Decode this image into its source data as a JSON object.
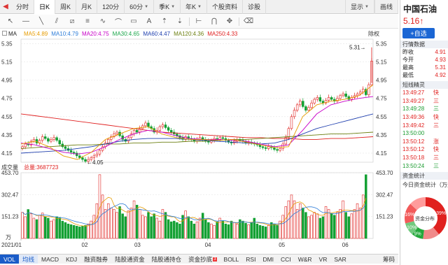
{
  "period_tabs": [
    "分时",
    "日K",
    "周K",
    "月K",
    "120分",
    "60分",
    "季K",
    "年K",
    "个股资料",
    "诊股"
  ],
  "period_active_index": 1,
  "period_right": [
    "显示",
    "画线"
  ],
  "ma_legend": {
    "label": "MA",
    "items": [
      {
        "label": "MA5:4.89",
        "color": "#e69b00"
      },
      {
        "label": "MA10:4.79",
        "color": "#2e7dd8"
      },
      {
        "label": "MA20:4.75",
        "color": "#c800c8"
      },
      {
        "label": "MA30:4.65",
        "color": "#1aa64a"
      },
      {
        "label": "MA60:4.47",
        "color": "#1f3fae"
      },
      {
        "label": "MA120:4.36",
        "color": "#6c7f10"
      },
      {
        "label": "MA250:4.33",
        "color": "#e02020"
      }
    ],
    "rq_label": "除权"
  },
  "chart_data": [
    {
      "type": "candlestick",
      "title": "",
      "y_axis_ticks": [
        "5.35",
        "5.15",
        "4.95",
        "4.75",
        "4.55",
        "4.35",
        "4.15"
      ],
      "ylim": [
        4.05,
        5.4
      ],
      "x_axis_ticks": [
        "2021/01",
        "02",
        "03",
        "04",
        "05",
        "06"
      ],
      "annotations": [
        {
          "text": "5.31",
          "value": 5.31
        },
        {
          "text": "4.05",
          "value": 4.05
        }
      ],
      "close_series": [
        4.22,
        4.25,
        4.24,
        4.28,
        4.3,
        4.26,
        4.29,
        4.33,
        4.31,
        4.28,
        4.3,
        4.32,
        4.29,
        4.25,
        4.22,
        4.2,
        4.18,
        4.16,
        4.15,
        4.12,
        4.1,
        4.08,
        4.06,
        4.08,
        4.1,
        4.12,
        4.14,
        4.18,
        4.22,
        4.26,
        4.3,
        4.33,
        4.36,
        4.38,
        4.34,
        4.3,
        4.28,
        4.32,
        4.36,
        4.4,
        4.38,
        4.42,
        4.45,
        4.48,
        4.44,
        4.42,
        4.38,
        4.4,
        4.44,
        4.46,
        4.43,
        4.4,
        4.38,
        4.36,
        4.34,
        4.32,
        4.3,
        4.33,
        4.31,
        4.3,
        4.28,
        4.3,
        4.32,
        4.3,
        4.28,
        4.27,
        4.29,
        4.31,
        4.3,
        4.32,
        4.31,
        4.29,
        4.27,
        4.26,
        4.28,
        4.3,
        4.29,
        4.28,
        4.26,
        4.27,
        4.26,
        4.25,
        4.24,
        4.22,
        4.21,
        4.2,
        4.22,
        4.21,
        4.19,
        4.18,
        4.2,
        4.25,
        4.32,
        4.42,
        4.55,
        4.62,
        4.68,
        4.72,
        4.66,
        4.62,
        4.65,
        4.7,
        4.74,
        4.76,
        4.72,
        4.7,
        4.73,
        4.76,
        4.74,
        4.72,
        4.75,
        4.78,
        4.8,
        4.77,
        4.74,
        4.76,
        4.78,
        4.8,
        4.82,
        4.85,
        4.79,
        4.9,
        5.16
      ],
      "ma_lines": [
        {
          "name": "MA250",
          "color": "#e02020",
          "values": [
            4.58,
            4.56,
            4.54,
            4.52,
            4.5,
            4.48,
            4.46,
            4.44,
            4.42,
            4.4,
            4.38,
            4.37,
            4.36,
            4.35,
            4.34,
            4.33,
            4.32,
            4.32,
            4.31,
            4.31,
            4.3,
            4.3,
            4.31,
            4.31,
            4.32,
            4.33
          ]
        },
        {
          "name": "MA120",
          "color": "#6c7f10",
          "values": [
            4.2,
            4.21,
            4.22,
            4.23,
            4.24,
            4.24,
            4.25,
            4.25,
            4.26,
            4.26,
            4.27,
            4.27,
            4.28,
            4.28,
            4.29,
            4.3,
            4.3,
            4.31,
            4.32,
            4.33,
            4.34,
            4.35,
            4.36,
            4.36,
            4.37,
            4.38
          ]
        },
        {
          "name": "MA60",
          "color": "#1f3fae",
          "values": [
            4.15,
            4.16,
            4.17,
            4.18,
            4.2,
            4.22,
            4.25,
            4.28,
            4.3,
            4.31,
            4.31,
            4.31,
            4.3,
            4.29,
            4.28,
            4.27,
            4.26,
            4.25,
            4.26,
            4.3,
            4.36,
            4.42,
            4.46,
            4.5,
            4.54,
            4.58
          ]
        },
        {
          "name": "MA20",
          "color": "#c800c8",
          "values": [
            4.26,
            4.24,
            4.2,
            4.16,
            4.14,
            4.16,
            4.22,
            4.3,
            4.36,
            4.4,
            4.38,
            4.34,
            4.31,
            4.3,
            4.3,
            4.29,
            4.28,
            4.25,
            4.22,
            4.24,
            4.4,
            4.58,
            4.68,
            4.72,
            4.75,
            4.77
          ]
        },
        {
          "name": "MA5",
          "color": "#e69b00",
          "values": [
            4.25,
            4.28,
            4.22,
            4.12,
            4.08,
            4.16,
            4.3,
            4.36,
            4.42,
            4.44,
            4.36,
            4.32,
            4.3,
            4.3,
            4.29,
            4.3,
            4.27,
            4.24,
            4.21,
            4.22,
            4.55,
            4.68,
            4.72,
            4.74,
            4.78,
            4.9
          ]
        }
      ]
    },
    {
      "type": "bar",
      "title": "成交量",
      "legend": "总量:3687723",
      "y_axis_ticks": [
        "453.70",
        "302.47",
        "151.23"
      ],
      "y_unit": "万",
      "ylim": [
        0,
        453.7
      ],
      "values": [
        180,
        150,
        200,
        170,
        140,
        130,
        160,
        175,
        150,
        140,
        120,
        130,
        150,
        145,
        120,
        110,
        100,
        95,
        90,
        85,
        80,
        85,
        90,
        100,
        120,
        160,
        240,
        440,
        300,
        200,
        240,
        210,
        200,
        180,
        220,
        170,
        150,
        190,
        210,
        260,
        230,
        200,
        160,
        150,
        180,
        150,
        170,
        140,
        120,
        200,
        180,
        130,
        115,
        120,
        110,
        100,
        160,
        190,
        150,
        120,
        100,
        115,
        140,
        175,
        130,
        110,
        100,
        90,
        115,
        140,
        120,
        100,
        95,
        120,
        110,
        100,
        130,
        120,
        105,
        95,
        110,
        140,
        100,
        90,
        85,
        80,
        95,
        110,
        100,
        90,
        120,
        160,
        220,
        260,
        300,
        260,
        200,
        240,
        210,
        180,
        150,
        160,
        180,
        170,
        140,
        150,
        220,
        200,
        170,
        160,
        180,
        200,
        260,
        180,
        150,
        170,
        200,
        240,
        210,
        300,
        440
      ],
      "ma_lines": [
        {
          "name": "VMA5",
          "color": "#e69b00"
        },
        {
          "name": "VMA10",
          "color": "#2e7dd8"
        }
      ]
    }
  ],
  "indicator_tabs": [
    "VOL",
    "均线",
    "MACD",
    "KDJ",
    "融资融券",
    "陆股通资金",
    "陆股通持仓",
    "资金抄底",
    "BOLL",
    "RSI",
    "DMI",
    "CCI",
    "W&R",
    "VR",
    "SAR"
  ],
  "indicator_badge": "3",
  "indicator_right": "筹码",
  "right_panel": {
    "stock_name": "中国石油",
    "price": "5.16",
    "price_arrow": "↑",
    "favorite_button": "+自选",
    "quote_section_title": "行情数据",
    "quote_rows": [
      {
        "label": "昨收",
        "value": "4.91"
      },
      {
        "label": "今开",
        "value": "4.93"
      },
      {
        "label": "最高",
        "value": "5.31"
      },
      {
        "label": "最低",
        "value": "4.92"
      }
    ],
    "short_section_title": "短线精灵",
    "short_rows": [
      {
        "time": "13:49:27",
        "text": "快",
        "color": "r"
      },
      {
        "time": "13:49:27",
        "text": "三",
        "color": "r"
      },
      {
        "time": "13:49:28",
        "text": "三",
        "color": "g"
      },
      {
        "time": "13:49:36",
        "text": "快",
        "color": "r"
      },
      {
        "time": "13:49:42",
        "text": "三",
        "color": "r"
      },
      {
        "time": "13:50:00",
        "text": "",
        "color": "g"
      },
      {
        "time": "13:50:12",
        "text": "涨",
        "color": "r"
      },
      {
        "time": "13:50:12",
        "text": "快",
        "color": "r"
      },
      {
        "time": "13:50:18",
        "text": "三",
        "color": "r"
      },
      {
        "time": "13:50:24",
        "text": "三",
        "color": "g"
      }
    ],
    "flow_section_title": "资金统计",
    "flow_subtitle": "今日资金统计（万元",
    "donut": {
      "center_label": "资金分布",
      "segments": [
        {
          "label": "39%",
          "value": 39,
          "color": "#e0211f"
        },
        {
          "label": "",
          "value": 13,
          "color": "#f08a8a"
        },
        {
          "label": "9%",
          "value": 9,
          "color": "#23a83b"
        },
        {
          "label": "10%",
          "value": 10,
          "color": "#71c97e"
        },
        {
          "label": "16%",
          "value": 16,
          "color": "#f25a5a"
        },
        {
          "label": "",
          "value": 13,
          "color": "#ff9c9c"
        }
      ]
    }
  }
}
